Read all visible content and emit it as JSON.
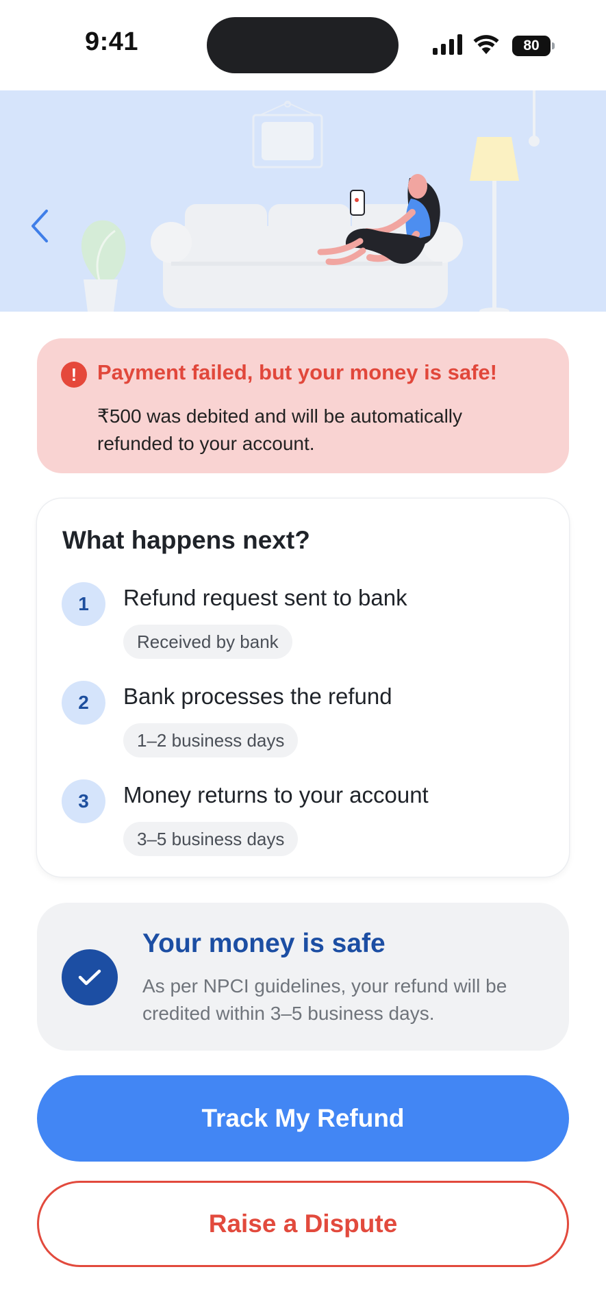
{
  "status_bar": {
    "time": "9:41",
    "battery": "80",
    "icons": [
      "signal-icon",
      "wifi-icon",
      "battery-icon"
    ]
  },
  "header": {
    "back_icon": "chevron-left-icon",
    "illustration": "woman-on-sofa-with-phone"
  },
  "alert": {
    "icon": "exclamation-circle-icon",
    "title": "Payment failed, but your money is safe!",
    "body": "₹500 was debited and will be automatically refunded to your account."
  },
  "next_steps": {
    "title": "What happens next?",
    "steps": [
      {
        "number": "1",
        "title": "Refund request sent to bank",
        "status": "Received by bank"
      },
      {
        "number": "2",
        "title": "Bank processes the refund",
        "status": "1–2 business days"
      },
      {
        "number": "3",
        "title": "Money returns to your account",
        "status": "3–5 business days"
      }
    ]
  },
  "safe_card": {
    "icon": "check-circle-icon",
    "title": "Your money is safe",
    "body": "As per NPCI guidelines, your refund will be credited within 3–5 business days."
  },
  "actions": {
    "primary_label": "Track My Refund",
    "secondary_label": "Raise a Dispute"
  },
  "colors": {
    "accent_blue": "#4286f4",
    "dark_blue": "#1c4ea3",
    "error_red": "#e24a3d",
    "alert_bg": "#f9d3d2",
    "hero_bg": "#d6e4fb"
  }
}
